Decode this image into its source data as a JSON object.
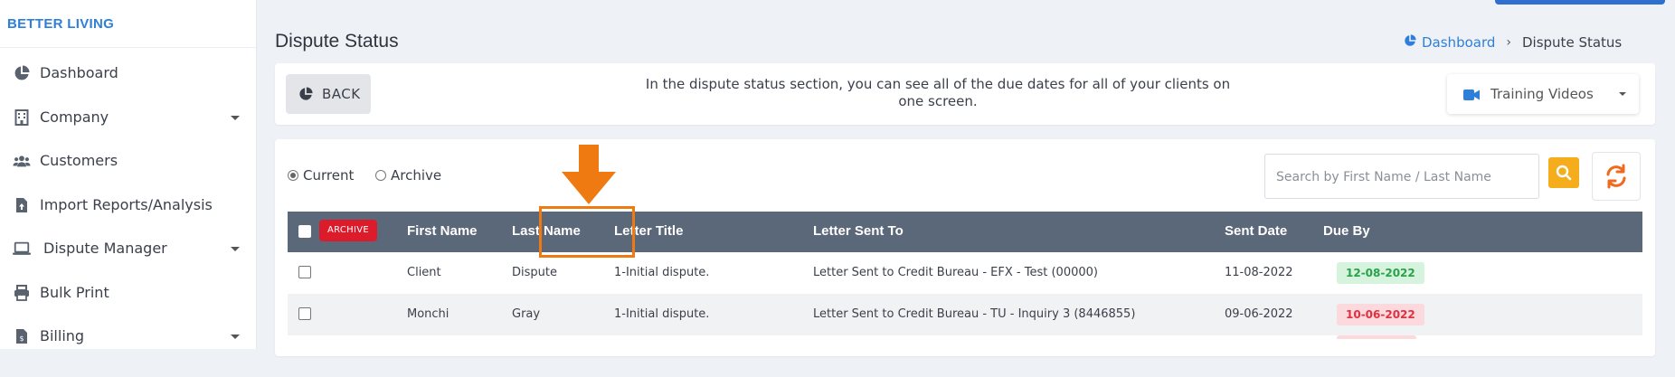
{
  "brand": "BETTER LIVING",
  "sidebar": {
    "items": [
      {
        "label": "Dashboard",
        "icon": "pie-chart-icon",
        "has_caret": false
      },
      {
        "label": "Company",
        "icon": "building-icon",
        "has_caret": true
      },
      {
        "label": "Customers",
        "icon": "users-icon",
        "has_caret": false
      },
      {
        "label": "Import Reports/Analysis",
        "icon": "file-upload-icon",
        "has_caret": false
      },
      {
        "label": "Dispute Manager",
        "icon": "laptop-icon",
        "has_caret": true
      },
      {
        "label": "Bulk Print",
        "icon": "printer-icon",
        "has_caret": false
      },
      {
        "label": "Billing",
        "icon": "invoice-icon",
        "has_caret": true
      }
    ]
  },
  "header": {
    "title": "Dispute Status",
    "breadcrumb": {
      "link": "Dashboard",
      "current": "Dispute Status"
    }
  },
  "toolbar": {
    "back_label": "BACK",
    "info_text": "In the dispute status section, you can see all of the due dates for all of your clients on one screen.",
    "training_label": "Training Videos"
  },
  "filters": {
    "current_label": "Current",
    "archive_label": "Archive",
    "selected": "Current"
  },
  "search": {
    "placeholder": "Search by First Name / Last Name"
  },
  "table": {
    "archive_button": "ARCHIVE",
    "headers": {
      "first_name": "First Name",
      "last_name": "Last Name",
      "letter_title": "Letter Title",
      "letter_sent_to": "Letter Sent To",
      "sent_date": "Sent Date",
      "due_by": "Due By"
    },
    "rows": [
      {
        "first_name": "Client",
        "last_name": "Dispute",
        "letter_title": "1-Initial dispute.",
        "letter_sent_to": "Letter Sent to Credit Bureau - EFX - Test (00000)",
        "sent_date": "11-08-2022",
        "due_by": "12-08-2022",
        "due_status": "ok"
      },
      {
        "first_name": "Monchi",
        "last_name": "Gray",
        "letter_title": "1-Initial dispute.",
        "letter_sent_to": "Letter Sent to Credit Bureau - TU - Inquiry 3 (8446855)",
        "sent_date": "09-06-2022",
        "due_by": "10-06-2022",
        "due_status": "overdue"
      }
    ]
  },
  "colors": {
    "brand": "#2e7fd9",
    "table_header": "#5b6879",
    "archive_button": "#dc1c2a",
    "search_button": "#f6ad1c",
    "refresh_icon": "#f06a1e",
    "annotation": "#f07a12",
    "badge_ok_bg": "#d6f3dd",
    "badge_ok_text": "#2aa24a",
    "badge_overdue_bg": "#fbd9dc",
    "badge_overdue_text": "#e1303f"
  }
}
